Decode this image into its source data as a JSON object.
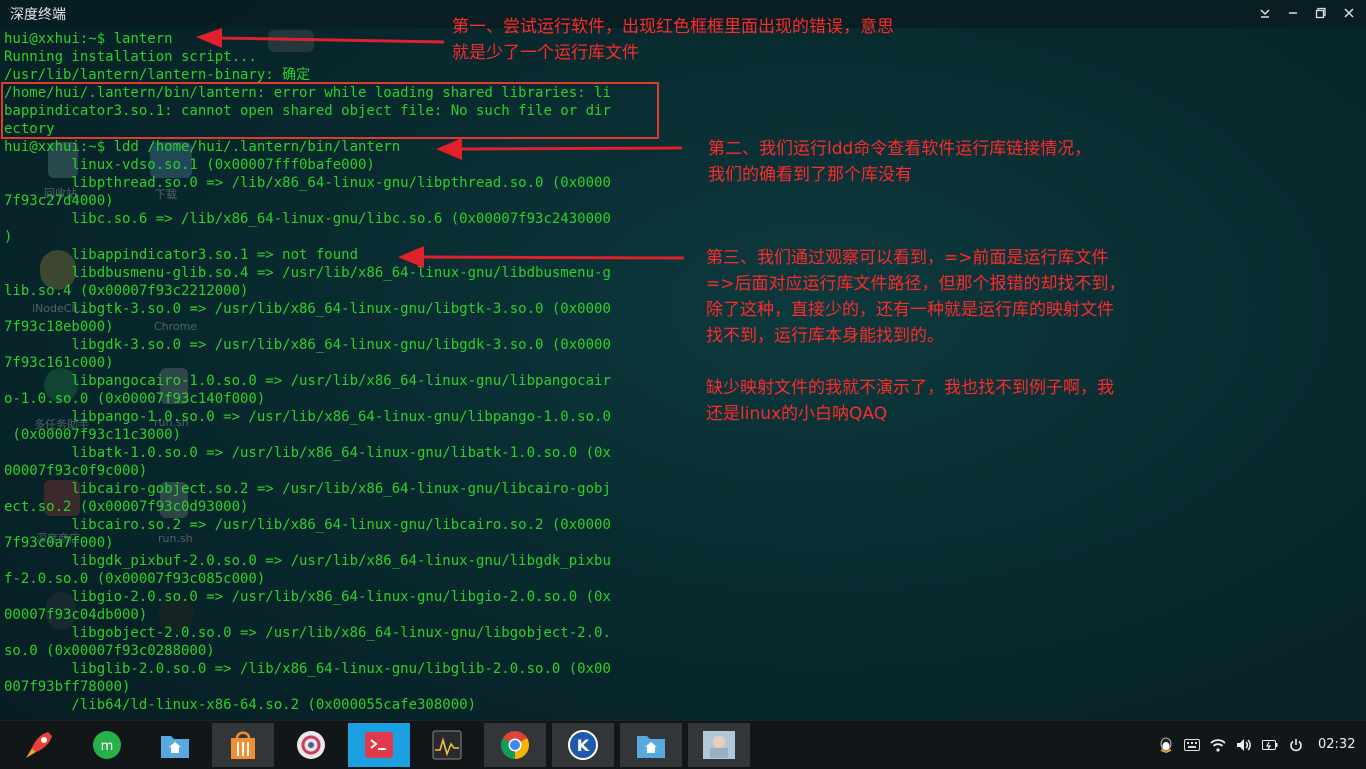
{
  "window": {
    "title": "深度终端"
  },
  "desktop": {
    "icon_labels": [
      "回收站",
      "下载",
      "iNodeCli...",
      "Chrome",
      "多任务助手",
      "run.sh",
      "深度商店",
      "run.sh"
    ]
  },
  "terminal": {
    "lines": [
      "hui@xxhui:~$ lantern",
      "Running installation script...",
      "/usr/lib/lantern/lantern-binary: 确定",
      "/home/hui/.lantern/bin/lantern: error while loading shared libraries: li",
      "bappindicator3.so.1: cannot open shared object file: No such file or dir",
      "ectory",
      "hui@xxhui:~$ ldd /home/hui/.lantern/bin/lantern",
      "        linux-vdso.so.1 (0x00007fff0bafe000)",
      "        libpthread.so.0 => /lib/x86_64-linux-gnu/libpthread.so.0 (0x0000",
      "7f93c27d4000)",
      "        libc.so.6 => /lib/x86_64-linux-gnu/libc.so.6 (0x00007f93c2430000",
      ")",
      "        libappindicator3.so.1 => not found",
      "        libdbusmenu-glib.so.4 => /usr/lib/x86_64-linux-gnu/libdbusmenu-g",
      "lib.so.4 (0x00007f93c2212000)",
      "        libgtk-3.so.0 => /usr/lib/x86_64-linux-gnu/libgtk-3.so.0 (0x0000",
      "7f93c18eb000)",
      "        libgdk-3.so.0 => /usr/lib/x86_64-linux-gnu/libgdk-3.so.0 (0x0000",
      "7f93c161c000)",
      "        libpangocairo-1.0.so.0 => /usr/lib/x86_64-linux-gnu/libpangocair",
      "o-1.0.so.0 (0x00007f93c140f000)",
      "        libpango-1.0.so.0 => /usr/lib/x86_64-linux-gnu/libpango-1.0.so.0",
      " (0x00007f93c11c3000)",
      "        libatk-1.0.so.0 => /usr/lib/x86_64-linux-gnu/libatk-1.0.so.0 (0x",
      "00007f93c0f9c000)",
      "        libcairo-gobject.so.2 => /usr/lib/x86_64-linux-gnu/libcairo-gobj",
      "ect.so.2 (0x00007f93c0d93000)",
      "        libcairo.so.2 => /usr/lib/x86_64-linux-gnu/libcairo.so.2 (0x0000",
      "7f93c0a7f000)",
      "        libgdk_pixbuf-2.0.so.0 => /usr/lib/x86_64-linux-gnu/libgdk_pixbu",
      "f-2.0.so.0 (0x00007f93c085c000)",
      "        libgio-2.0.so.0 => /usr/lib/x86_64-linux-gnu/libgio-2.0.so.0 (0x",
      "00007f93c04db000)",
      "        libgobject-2.0.so.0 => /usr/lib/x86_64-linux-gnu/libgobject-2.0.",
      "so.0 (0x00007f93c0288000)",
      "        libglib-2.0.so.0 => /lib/x86_64-linux-gnu/libglib-2.0.so.0 (0x00",
      "007f93bff78000)",
      "        /lib64/ld-linux-x86-64.so.2 (0x000055cafe308000)"
    ]
  },
  "annotations": {
    "note1": {
      "line1": "第一、尝试运行软件，出现红色框框里面出现的错误，意思",
      "line2": "就是少了一个运行库文件"
    },
    "note2": {
      "line1": "第二、我们运行ldd命令查看软件运行库链接情况，",
      "line2": "我们的确看到了那个库没有"
    },
    "note3": {
      "line1": "第三、我们通过观察可以看到，=>前面是运行库文件",
      "line2": "=>后面对应运行库文件路径，但那个报错的却找不到，",
      "line3": "除了这种，直接少的，还有一种就是运行库的映射文件",
      "line4": "找不到，运行库本身能找到的。",
      "line5": "",
      "line6": "缺少映射文件的我就不演示了，我也找不到例子啊，我",
      "line7": "还是linux的小白呐QAQ"
    },
    "color": "#ff2a2a"
  },
  "taskbar": {
    "clock": "02:32",
    "dock_items": [
      "launcher-icon",
      "deepin-store-icon",
      "file-manager-icon",
      "app-store-icon",
      "settings-icon",
      "terminal-icon",
      "system-monitor-icon",
      "chrome-icon",
      "k-app-icon",
      "files-icon",
      "image-viewer-icon"
    ],
    "tray_items": [
      "qq-icon",
      "keyboard-icon",
      "wifi-icon",
      "volume-icon",
      "battery-icon",
      "power-icon"
    ]
  }
}
